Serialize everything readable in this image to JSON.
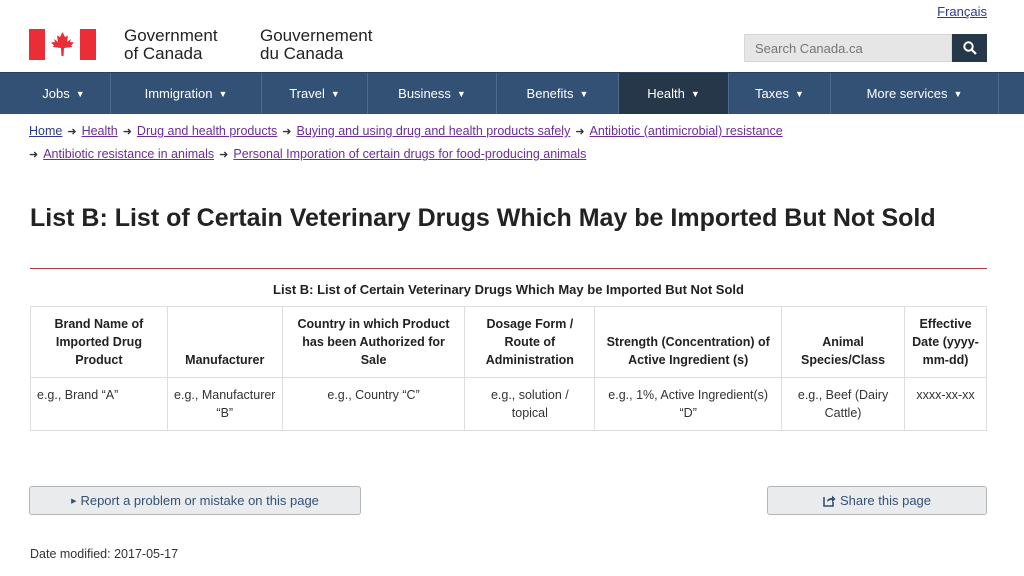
{
  "language_link": "Français",
  "header": {
    "gov_en_line1": "Government",
    "gov_en_line2": "of Canada",
    "gov_fr_line1": "Gouvernement",
    "gov_fr_line2": "du Canada",
    "search_placeholder": "Search Canada.ca"
  },
  "colors": {
    "menu_bg": "#335075",
    "menu_active": "#26374a",
    "flag_red": "#eb2d37",
    "title_rule": "#af3c43",
    "visited_link": "#6a2d99"
  },
  "menu": [
    {
      "label": "Jobs"
    },
    {
      "label": "Immigration"
    },
    {
      "label": "Travel"
    },
    {
      "label": "Business"
    },
    {
      "label": "Benefits"
    },
    {
      "label": "Health"
    },
    {
      "label": "Taxes"
    },
    {
      "label": "More services"
    }
  ],
  "breadcrumb": [
    "Home",
    "Health",
    "Drug and health products",
    "Buying and using drug and health products safely",
    "Antibiotic (antimicrobial) resistance",
    "Antibiotic resistance in animals",
    "Personal Imporation of certain drugs for food-producing animals"
  ],
  "page_title": "List B: List of Certain Veterinary Drugs Which May be Imported But Not Sold",
  "table": {
    "caption": "List B: List of Certain Veterinary Drugs Which May be Imported But Not Sold",
    "headers": [
      "Brand Name of Imported Drug Product",
      "Manufacturer",
      "Country in which Product has been Authorized for Sale",
      "Dosage Form / Route of Administration",
      "Strength (Concentration) of Active Ingredient (s)",
      "Animal Species/Class",
      "Effective Date (yyyy-mm-dd)"
    ],
    "row": [
      "e.g., Brand “A”",
      "e.g., Manufacturer “B”",
      "e.g., Country “C”",
      "e.g., solution / topical",
      "e.g., 1%, Active Ingredient(s) “D”",
      "e.g., Beef (Dairy Cattle)",
      "xxxx-xx-xx"
    ]
  },
  "report_button": "Report a problem or mistake on this page",
  "share_button": "Share this page",
  "date_modified_label": "Date modified:",
  "date_modified_value": "2017-05-17"
}
